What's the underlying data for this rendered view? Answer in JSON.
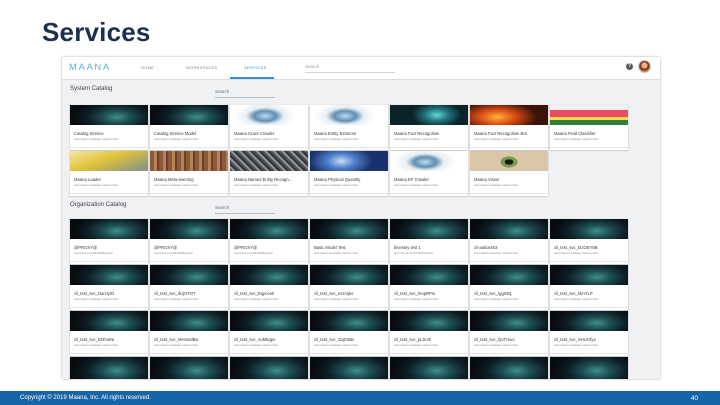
{
  "slide": {
    "title": "Services",
    "footer_copyright": "Copyright © 2019 Maana, Inc.  All rights reserved.",
    "page_number": "40"
  },
  "app": {
    "logo": "MAANA",
    "nav": {
      "home": "HOME",
      "workspaces": "WORKSPACES",
      "services": "SERVICES"
    },
    "search_placeholder": "Search",
    "help_icon": "?"
  },
  "system_catalog": {
    "title": "System Catalog",
    "search_placeholder": "Search",
    "cards": [
      {
        "title": "Catalog Service",
        "url": "https://latest.knowledge.maana.io:844...",
        "thumb": "teal"
      },
      {
        "title": "Catalog Service Model",
        "url": "https://latest.knowledge.maana.io:844...",
        "thumb": "teal"
      },
      {
        "title": "Maana Azure Crawler",
        "url": "https://latest.knowledge.maana.io:844...",
        "thumb": "orb"
      },
      {
        "title": "Maana Entity Extractor",
        "url": "https://latest.knowledge.maana.io:844...",
        "thumb": "orb"
      },
      {
        "title": "Maana Fact Recognition",
        "url": "https://latest.knowledge.maana.io:844...",
        "thumb": "jelly"
      },
      {
        "title": "Maana Fact Recognition Bot",
        "url": "https://latest.knowledge.maana.io:844...",
        "thumb": "fire"
      },
      {
        "title": "Maana Field Classifier",
        "url": "https://latest.knowledge.maana.io:844...",
        "thumb": "flowers"
      },
      {
        "title": "Maana Loader",
        "url": "https://latest.knowledge.maana.io:844...",
        "thumb": "yellow"
      },
      {
        "title": "Maana Meta-learning",
        "url": "https://latest.knowledge.maana.io:844...",
        "thumb": "wood"
      },
      {
        "title": "Maana Named Entity Recogn...",
        "url": "https://latest.knowledge.maana.io:844...",
        "thumb": "grid"
      },
      {
        "title": "Maana Physical Quantity",
        "url": "https://latest.knowledge.maana.io:844...",
        "thumb": "blue"
      },
      {
        "title": "Maana EF Crawler",
        "url": "https://latest.knowledge.maana.io:844...",
        "thumb": "orb"
      },
      {
        "title": "Maana Vision",
        "url": "https://latest.knowledge.maana.io:844...",
        "thumb": "eye"
      }
    ]
  },
  "organization_catalog": {
    "title": "Organization Catalog",
    "search_placeholder": "Search",
    "cards": [
      {
        "title": "@PROXY@",
        "url": "http://maana-knoldb:8008/graphql"
      },
      {
        "title": "@PROXY@",
        "url": "http://maana-knoldb:8008/graphql"
      },
      {
        "title": "@PROXY@",
        "url": "http://maana-knoldb:8008/graphql"
      },
      {
        "title": "Basic Model Test",
        "url": "https://latest.knowledge.maana.io:844..."
      },
      {
        "title": "bivestey test 1",
        "url": "http://172.16.79.156:3000/graphql"
      },
      {
        "title": "cli-aalice463",
        "url": "https://latest.knowledge.maana.io:844..."
      },
      {
        "title": "cli_test_svc_bGOEY8B",
        "url": "https://latest.knowledge.maana.io:844..."
      },
      {
        "title": "cli_test_svc_DanJyrD",
        "url": "https://latest.knowledge.maana.io:844..."
      },
      {
        "title": "cli_test_svc_dUjOTDT",
        "url": "https://latest.knowledge.maana.io:844..."
      },
      {
        "title": "cli_test_svc_Eqpceek",
        "url": "https://latest.knowledge.maana.io:844..."
      },
      {
        "title": "cli_test_svc_ezzmjko",
        "url": "https://latest.knowledge.maana.io:844..."
      },
      {
        "title": "cli_test_svc_hmpRPni",
        "url": "https://latest.knowledge.maana.io:844..."
      },
      {
        "title": "cli_test_svc_IggrN5j",
        "url": "https://latest.knowledge.maana.io:844..."
      },
      {
        "title": "cli_test_svc_kbnYLP",
        "url": "https://latest.knowledge.maana.io:844..."
      },
      {
        "title": "cli_test_svc_kZKVaNi",
        "url": "https://latest.knowledge.maana.io:844..."
      },
      {
        "title": "cli_test_svc_MHmndBw",
        "url": "https://latest.knowledge.maana.io:844..."
      },
      {
        "title": "cli_test_svc_nuM5qpe",
        "url": "https://latest.knowledge.maana.io:844..."
      },
      {
        "title": "cli_test_svc_OqDSBv",
        "url": "https://latest.knowledge.maana.io:844..."
      },
      {
        "title": "cli_test_svc_pLSrzti",
        "url": "https://latest.knowledge.maana.io:844..."
      },
      {
        "title": "cli_test_svc_QuTOwo",
        "url": "https://latest.knowledge.maana.io:844..."
      },
      {
        "title": "cli_test_svc_SHUGfya",
        "url": "https://latest.knowledge.maana.io:844..."
      }
    ]
  }
}
